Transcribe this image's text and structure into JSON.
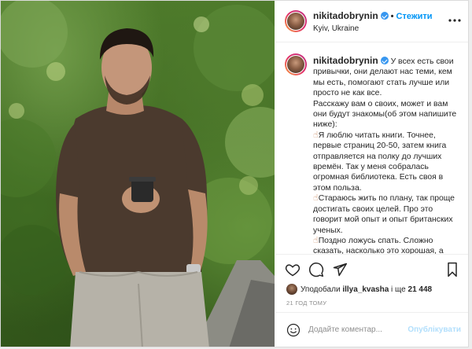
{
  "post": {
    "username": "nikitadobrynin",
    "follow_label": "Стежити",
    "separator": "•",
    "location": "Kyiv, Ukraine",
    "more_icon": "more-horizontal-icon",
    "caption": {
      "author": "nikitadobrynin",
      "intro": "У всех есть свои привычки, они делают нас теми, кем мы есть, помогают стать лучше или просто не как все.",
      "lead": "Расскажу вам о своих, может и вам они будут знакомы(об этом напишите ниже):",
      "items": [
        "Я люблю читать книги. Точнее, первые страниц 20-50, затем книга отправляется на полку до лучших времён. Так у меня собралась огромная библиотека. Есть своя в этом польза.",
        "Стараюсь жить по плану, так проще достигать своих целей. Про это говорит мой опыт и опыт британских ученых.",
        "Поздно ложусь спать. Сложно сказать, насколько это хорошая, а"
      ]
    },
    "likes": {
      "prefix": "Уподобали",
      "user": "illya_kvasha",
      "middle": "і ще",
      "count": "21 448"
    },
    "time": "21 ГОД ТОМУ",
    "comment": {
      "placeholder": "Додайте коментар...",
      "publish_label": "Опублікувати"
    },
    "colors": {
      "accent": "#0095f6",
      "publish_disabled": "#b2dffc",
      "verified": "#3897f0"
    }
  }
}
